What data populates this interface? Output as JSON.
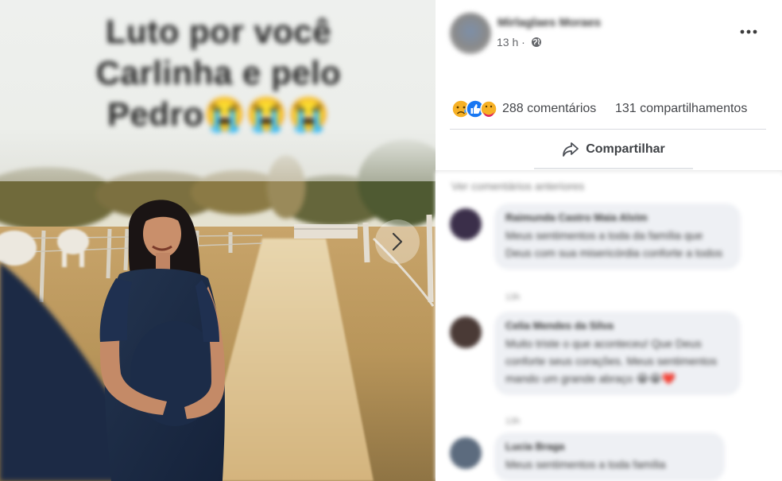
{
  "post": {
    "caption": [
      "Luto por você",
      "Carlinha e pelo",
      "Pedro😭😭😭"
    ],
    "author_name": "Mirlaglaes Moraes",
    "time": "13 h ·",
    "reactions": [
      "sad",
      "like",
      "care"
    ],
    "comments_label": "288 comentários",
    "shares_label": "131 compartilhamentos",
    "share_button_label": "Compartilhar"
  },
  "comments": {
    "view_more": "Ver comentários anteriores",
    "items": [
      {
        "name": "Raimunda Castro Maia Alvim",
        "text": "Meus sentimentos a toda da família que Deus com sua misericórdia conforte a todos",
        "meta": "13h"
      },
      {
        "name": "Celia Mendes da Silva",
        "text": "Muito triste o que aconteceu! Que Deus conforte seus corações. Meus sentimentos mando um grande abraço 😭😭❤️",
        "meta": "13h"
      },
      {
        "name": "Lucia Braga",
        "text": "Meus sentimentos a toda família",
        "meta": ""
      }
    ]
  },
  "colors": {
    "accent": "#1877f2",
    "text_primary": "#45474b",
    "divider": "#d8dadf",
    "comment_bubble": "#eef0f4"
  },
  "icons": {
    "globe": "globe-icon",
    "more": "more-horizontal-icon",
    "share": "share-arrow-icon",
    "next": "chevron-right-icon"
  }
}
